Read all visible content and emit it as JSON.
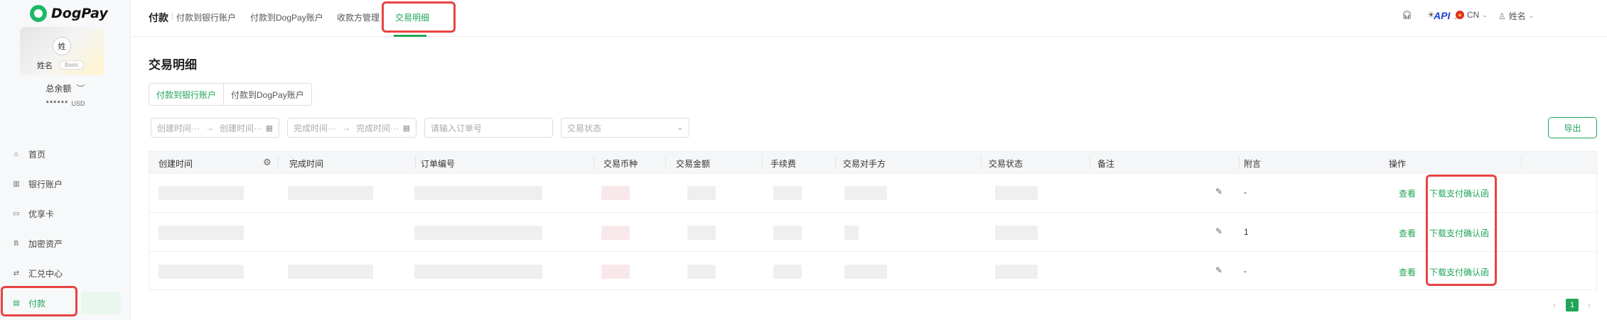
{
  "app": {
    "logo_text": "DogPay",
    "api_label": "API"
  },
  "user": {
    "avatar_text": "姓",
    "name": "姓名",
    "badge": "Basic",
    "balance_label": "总余额",
    "balance_masked": "******",
    "currency": "USD"
  },
  "sidebar": {
    "items": [
      {
        "label": "首页",
        "icon": "home-icon",
        "glyph": "⌂"
      },
      {
        "label": "银行账户",
        "icon": "bank-icon",
        "glyph": "▥"
      },
      {
        "label": "优享卡",
        "icon": "card-icon",
        "glyph": "▭"
      },
      {
        "label": "加密资产",
        "icon": "crypto-icon",
        "glyph": "B"
      },
      {
        "label": "汇兑中心",
        "icon": "exchange-icon",
        "glyph": "⇄"
      },
      {
        "label": "付款",
        "icon": "payment-icon",
        "glyph": "▤"
      }
    ]
  },
  "topbar": {
    "section": "付款",
    "tabs": [
      "付款到银行账户",
      "付款到DogPay账户",
      "收款方管理",
      "交易明细"
    ],
    "language": "CN",
    "user_name": "姓名"
  },
  "main": {
    "title": "交易明细",
    "segments": [
      "付款到银行账户",
      "付款到DogPay账户"
    ],
    "filters": {
      "created_start": "创建时间···",
      "created_end": "创建时间···",
      "finished_start": "完成时间···",
      "finished_end": "完成时间···",
      "order_placeholder": "请输入订单号",
      "status_placeholder": "交易状态"
    },
    "export_label": "导出"
  },
  "table": {
    "columns": [
      "创建时间",
      "完成时间",
      "订单编号",
      "交易币种",
      "交易金额",
      "手续费",
      "交易对手方",
      "交易状态",
      "备注",
      "附言",
      "操作"
    ],
    "rows": [
      {
        "postscript": "-",
        "view": "查看",
        "download": "下载支付确认函"
      },
      {
        "postscript": "1",
        "view": "查看",
        "download": "下载支付确认函"
      },
      {
        "postscript": "-",
        "view": "查看",
        "download": "下载支付确认函"
      }
    ]
  },
  "pagination": {
    "current": "1",
    "prev": "‹",
    "next": "›"
  }
}
